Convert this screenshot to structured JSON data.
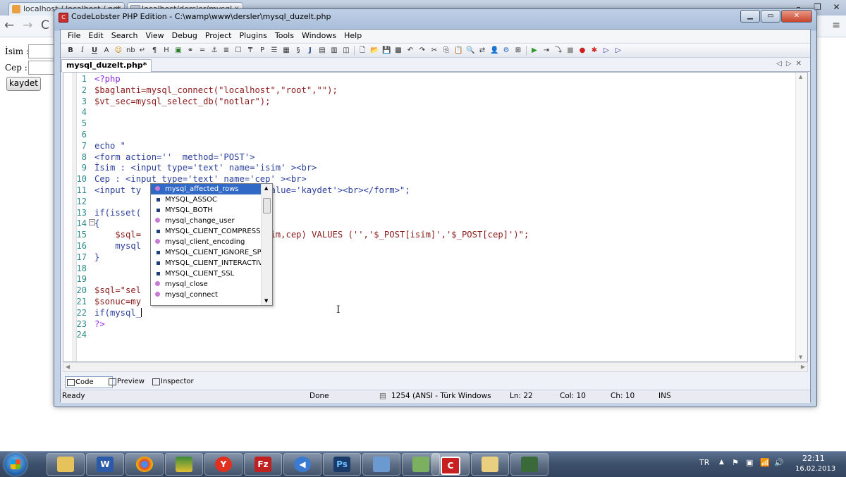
{
  "browser": {
    "tabs": [
      {
        "label": "localhost / localhost / not..."
      },
      {
        "label": "localhost/dersler/mysql..."
      }
    ],
    "tab_close": "×",
    "page": {
      "isim_label": "İsim :",
      "cep_label": "Cep :",
      "kaydet_label": "kaydet"
    }
  },
  "editor_window": {
    "title": "CodeLobster PHP Edition - C:\\wamp\\www\\dersler\\mysql_duzelt.php",
    "menu": [
      "File",
      "Edit",
      "Search",
      "View",
      "Debug",
      "Project",
      "Plugins",
      "Tools",
      "Windows",
      "Help"
    ],
    "doc_tab": "mysql_duzelt.php*",
    "code_lines": [
      {
        "n": "1",
        "text": "<?php"
      },
      {
        "n": "2",
        "text": "$baglanti=mysql_connect(\"localhost\",\"root\",\"\");"
      },
      {
        "n": "3",
        "text": "$vt_sec=mysql_select_db(\"notlar\");"
      },
      {
        "n": "4",
        "text": ""
      },
      {
        "n": "5",
        "text": ""
      },
      {
        "n": "6",
        "text": ""
      },
      {
        "n": "7",
        "text": "echo \""
      },
      {
        "n": "8",
        "text": "<form action=''  method='POST'>"
      },
      {
        "n": "9",
        "text": "İsim : <input type='text' name='isim' ><br>"
      },
      {
        "n": "10",
        "text": "Cep : <input type='text' name='cep' ><br>"
      },
      {
        "n": "11",
        "text": "<input ty                 aydet' value='kaydet'><br></form>\";"
      },
      {
        "n": "12",
        "text": ""
      },
      {
        "n": "13",
        "text": "if(isset("
      },
      {
        "n": "14",
        "text": "{"
      },
      {
        "n": "15",
        "text": "    $sql=                   (id,isim,cep) VALUES ('','$_POST[isim]','$_POST[cep]')\";"
      },
      {
        "n": "16",
        "text": "    mysql"
      },
      {
        "n": "17",
        "text": "}"
      },
      {
        "n": "18",
        "text": ""
      },
      {
        "n": "19",
        "text": ""
      },
      {
        "n": "20",
        "text": "$sql=\"sel"
      },
      {
        "n": "21",
        "text": "$sonuc=my                  anti);"
      },
      {
        "n": "22",
        "text": "if(mysql_"
      },
      {
        "n": "23",
        "text": "?>"
      },
      {
        "n": "24",
        "text": ""
      }
    ],
    "autocomplete": [
      {
        "label": "mysql_affected_rows",
        "kind": "fn",
        "selected": true
      },
      {
        "label": "MYSQL_ASSOC",
        "kind": "const"
      },
      {
        "label": "MYSQL_BOTH",
        "kind": "const"
      },
      {
        "label": "mysql_change_user",
        "kind": "fn"
      },
      {
        "label": "MYSQL_CLIENT_COMPRESS",
        "kind": "const"
      },
      {
        "label": "mysql_client_encoding",
        "kind": "fn"
      },
      {
        "label": "MYSQL_CLIENT_IGNORE_SP...",
        "kind": "const"
      },
      {
        "label": "MYSQL_CLIENT_INTERACTIV",
        "kind": "const"
      },
      {
        "label": "MYSQL_CLIENT_SSL",
        "kind": "const"
      },
      {
        "label": "mysql_close",
        "kind": "fn"
      },
      {
        "label": "mysql_connect",
        "kind": "fn"
      }
    ],
    "view_tabs": [
      "Code",
      "Preview",
      "Inspector"
    ],
    "status": {
      "ready": "Ready",
      "done": "Done",
      "encoding": "1254 (ANSI - Türk Windows",
      "ln": "Ln: 22",
      "col": "Col: 10",
      "ch": "Ch: 10",
      "mode": "INS"
    }
  },
  "taskbar": {
    "lang": "TR",
    "time": "22:11",
    "date": "16.02.2013"
  }
}
